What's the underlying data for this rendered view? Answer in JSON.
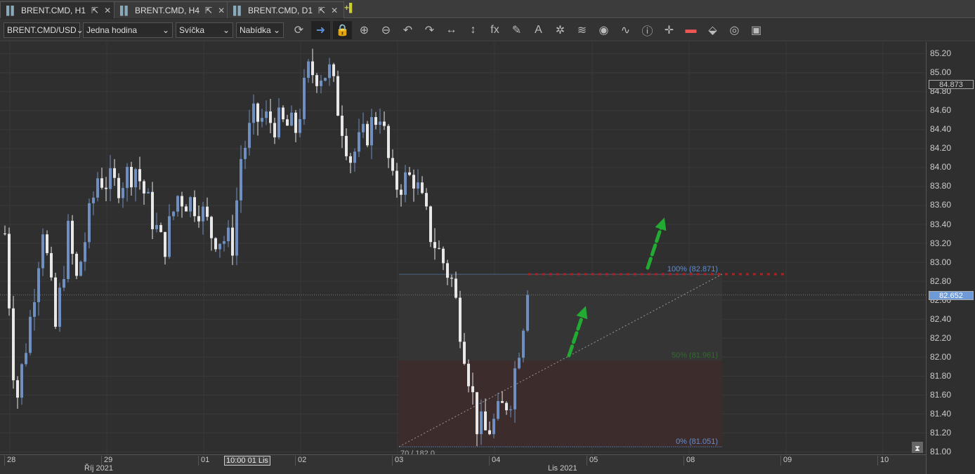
{
  "tabs": [
    {
      "label": "BRENT.CMD, H1",
      "active": true
    },
    {
      "label": "BRENT.CMD, H4"
    },
    {
      "label": "BRENT.CMD, D1"
    }
  ],
  "toolbar": {
    "symbol": "BRENT.CMD/USD",
    "timeframe": "Jedna hodina",
    "chart_type": "Svíčka",
    "price_type": "Nabídka",
    "icons": [
      "refresh-icon",
      "autoscroll-icon",
      "lock-icon",
      "zoom-in-icon",
      "zoom-out-icon",
      "undo-icon",
      "redo-icon",
      "horizontal-scale-icon",
      "vertical-scale-icon",
      "indicators-fx-icon",
      "pencil-icon",
      "text-icon",
      "objects-icon",
      "layers-icon",
      "eye-icon",
      "signals-icon",
      "info-icon",
      "crosshair-icon",
      "colors-icon",
      "fill-icon",
      "template-icon",
      "save-icon"
    ]
  },
  "price_axis": {
    "labels": [
      "85.20",
      "85.00",
      "84.80",
      "84.60",
      "84.40",
      "84.20",
      "84.00",
      "83.80",
      "83.60",
      "83.40",
      "83.20",
      "83.00",
      "82.80",
      "82.60",
      "82.40",
      "82.20",
      "82.00",
      "81.80",
      "81.60",
      "81.40",
      "81.20",
      "81.00"
    ],
    "high_badge": "84.873",
    "current_badge": "82.652"
  },
  "time_axis": {
    "dates": [
      "28",
      "29",
      "01",
      "02",
      "03",
      "04",
      "05",
      "08",
      "09",
      "10"
    ],
    "cursor_label": "10:00 01 Lis",
    "months": [
      "Říj 2021",
      "Lis 2021"
    ]
  },
  "fibonacci": {
    "level_100": "100% (82.871)",
    "level_50": "50% (81.961)",
    "level_0": "0% (81.051)",
    "ratio_label": "70 / 182.0"
  },
  "colors": {
    "bull": "#6f8fc0",
    "bear": "#e8e8e8",
    "fib_red": "#b02020",
    "arrow": "#22aa33",
    "accent": "#5b8fd6"
  },
  "chart_data": {
    "type": "candlestick",
    "symbol": "BRENT.CMD",
    "timeframe": "H1",
    "ylim": [
      81.0,
      85.2
    ],
    "path": [
      [
        0,
        83.3
      ],
      [
        2,
        81.9
      ],
      [
        3,
        81.6
      ],
      [
        6,
        82.4
      ],
      [
        9,
        83.4
      ],
      [
        12,
        82.3
      ],
      [
        15,
        83.3
      ],
      [
        17,
        82.8
      ],
      [
        22,
        83.9
      ],
      [
        26,
        83.8
      ],
      [
        31,
        84.0
      ],
      [
        37,
        83.2
      ],
      [
        38,
        83.2
      ],
      [
        41,
        83.7
      ],
      [
        46,
        83.6
      ],
      [
        49,
        83.3
      ],
      [
        54,
        83.2
      ],
      [
        56,
        84.1
      ],
      [
        59,
        84.5
      ],
      [
        62,
        84.5
      ],
      [
        69,
        84.4
      ],
      [
        72,
        85.0
      ],
      [
        77,
        85.0
      ],
      [
        82,
        84.1
      ],
      [
        85,
        84.3
      ],
      [
        89,
        84.6
      ],
      [
        92,
        83.8
      ],
      [
        97,
        83.9
      ],
      [
        101,
        83.3
      ],
      [
        106,
        82.8
      ],
      [
        109,
        82.1
      ],
      [
        112,
        81.3
      ],
      [
        114,
        81.2
      ],
      [
        116,
        81.3
      ],
      [
        120,
        81.6
      ],
      [
        123,
        82.4
      ],
      [
        124,
        82.65
      ]
    ]
  }
}
